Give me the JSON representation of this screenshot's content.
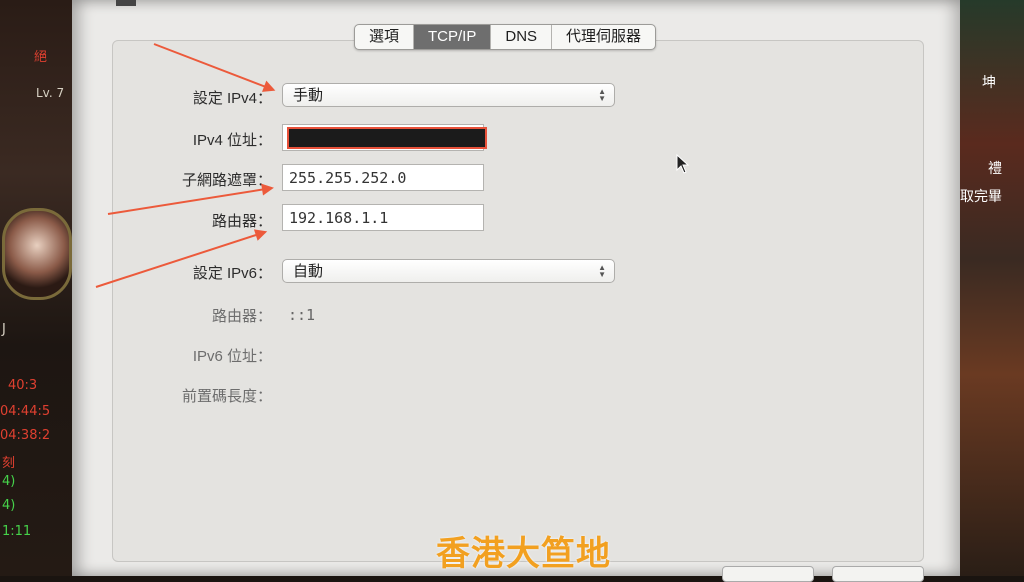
{
  "tabs": [
    {
      "label": "選項",
      "active": false
    },
    {
      "label": "TCP/IP",
      "active": true
    },
    {
      "label": "DNS",
      "active": false
    },
    {
      "label": "代理伺服器",
      "active": false
    }
  ],
  "ipv4": {
    "config_label": "設定 IPv4：",
    "config_value": "手動",
    "address_label": "IPv4 位址：",
    "subnet_label": "子網路遮罩：",
    "subnet_value": "255.255.252.0",
    "router_label": "路由器：",
    "router_value": "192.168.1.1"
  },
  "ipv6": {
    "config_label": "設定 IPv6：",
    "config_value": "自動",
    "router_label": "路由器：",
    "router_value": "::1",
    "address_label": "IPv6 位址：",
    "prefix_label": "前置碼長度："
  },
  "watermark": "香港大笪地",
  "background_left": {
    "name_chip": "絕",
    "level": "Lv. 7",
    "times": [
      "40:3",
      "04:44:5",
      "04:38:2",
      "1:11"
    ],
    "misc": [
      "J",
      "4)",
      "4)",
      "刻"
    ]
  },
  "background_right": {
    "labels": [
      "坤",
      "禮",
      "取完畢"
    ]
  },
  "colors": {
    "annotation": "#ec5a3b",
    "watermark": "#f2a020",
    "active_tab": "#6e6e6e"
  }
}
